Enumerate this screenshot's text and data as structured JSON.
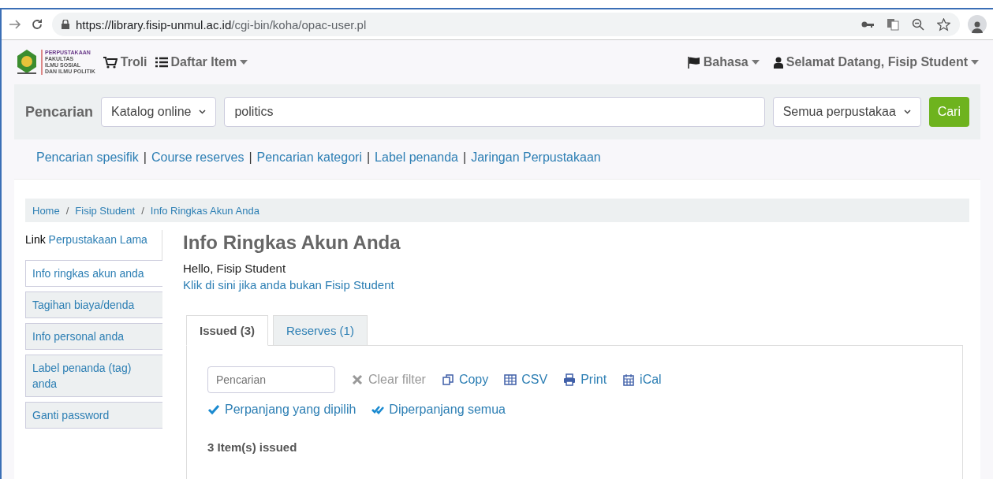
{
  "browser": {
    "url_host": "https://library.fisip-unmul.ac.id",
    "url_path": "/cgi-bin/koha/opac-user.pl"
  },
  "logo": {
    "lines": [
      "PERPUSTAKAAN",
      "FAKULTAS",
      "ILMU SOSIAL",
      "DAN ILMU POLITIK"
    ]
  },
  "navbar": {
    "cart": "Troli",
    "lists": "Daftar Item",
    "language": "Bahasa",
    "user": "Selamat Datang, Fisip Student"
  },
  "search": {
    "label": "Pencarian",
    "type": "Katalog online",
    "query": "politics",
    "library": "Semua perpustakaa",
    "button": "Cari"
  },
  "links": {
    "separator": "|",
    "items": [
      "Pencarian spesifik",
      "Course reserves",
      "Pencarian kategori",
      "Label penanda",
      "Jaringan Perpustakaan"
    ]
  },
  "breadcrumbs": {
    "separator": "/",
    "items": [
      "Home",
      "Fisip Student",
      "Info Ringkas Akun Anda"
    ]
  },
  "sidebar": {
    "prefix": "Link",
    "link": "Perpustakaan Lama",
    "items": [
      {
        "label": "Info ringkas akun anda",
        "selected": true
      },
      {
        "label": "Tagihan biaya/denda",
        "selected": false
      },
      {
        "label": "Info personal anda",
        "selected": false
      },
      {
        "label": "Label penanda (tag) anda",
        "selected": false
      },
      {
        "label": "Ganti password",
        "selected": false
      }
    ]
  },
  "main": {
    "title": "Info Ringkas Akun Anda",
    "greeting": "Hello, Fisip Student",
    "not_you": "Klik di sini jika anda bukan Fisip Student"
  },
  "tabs": [
    {
      "label": "Issued (3)",
      "selected": true
    },
    {
      "label": "Reserves (1)",
      "selected": false
    }
  ],
  "filter": {
    "placeholder": "Pencarian"
  },
  "actions": [
    {
      "kind": "clear",
      "label": "Clear filter",
      "disabled": true
    },
    {
      "kind": "copy",
      "label": "Copy",
      "disabled": false
    },
    {
      "kind": "csv",
      "label": "CSV",
      "disabled": false
    },
    {
      "kind": "print",
      "label": "Print",
      "disabled": false
    },
    {
      "kind": "ical",
      "label": "iCal",
      "disabled": false
    },
    {
      "kind": "renew",
      "label": "Perpanjang yang dipilih",
      "disabled": false
    },
    {
      "kind": "renew-all",
      "label": "Diperpanjang semua",
      "disabled": false
    }
  ],
  "issued_count": "3 Item(s) issued"
}
